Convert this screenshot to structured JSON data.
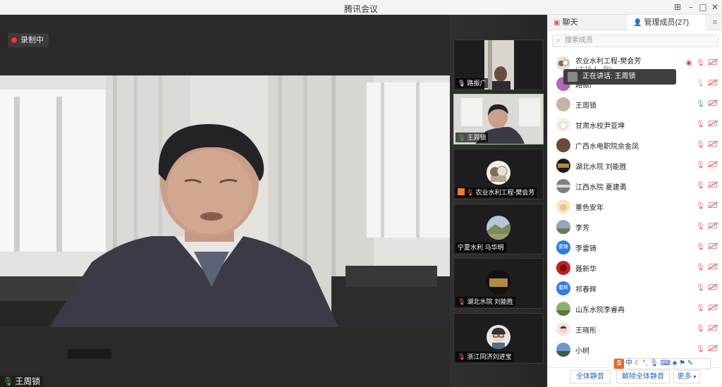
{
  "window": {
    "title": "腾讯会议"
  },
  "stage": {
    "recording_label": "录制中",
    "speaker_name": "王周锁"
  },
  "video_strip": [
    {
      "name": "路振广",
      "mic": "on"
    },
    {
      "name": "王周锁",
      "mic": "speaking"
    },
    {
      "name": "农业水利工程-樊会芳",
      "mic": "muted",
      "host": true
    },
    {
      "name": "宁夏水利 马华明",
      "mic": "none"
    },
    {
      "name": "湖北水院 刘能胜",
      "mic": "muted"
    },
    {
      "name": "浙江同济刘进宝",
      "mic": "muted"
    }
  ],
  "panel": {
    "tab_chat": "聊天",
    "tab_members": "管理成员(27)",
    "search_placeholder": "搜索成员",
    "speaking_tip": "正在讲话: 王周锁",
    "host_sub": "(主持人, 我)",
    "members": [
      {
        "name": "农业水利工程-樊会芳",
        "mic": "off",
        "recording": true
      },
      {
        "name": "路振广",
        "mic": "idle"
      },
      {
        "name": "王周锁",
        "mic": "on"
      },
      {
        "name": "甘肃水校尹亚坤",
        "mic": "off"
      },
      {
        "name": "广西水电职院余金凤",
        "mic": "off"
      },
      {
        "name": "湖北水院 刘能胜",
        "mic": "off"
      },
      {
        "name": "江西水院 夏建勇",
        "mic": "off"
      },
      {
        "name": "董色安年",
        "mic": "off"
      },
      {
        "name": "李芳",
        "mic": "off"
      },
      {
        "name": "李雷铸",
        "mic": "off",
        "avatar_text": "雷铸",
        "avatar_color": "#2f7be5"
      },
      {
        "name": "聂新华",
        "mic": "off"
      },
      {
        "name": "祁春辉",
        "mic": "off",
        "avatar_text": "春辉",
        "avatar_color": "#2f7be5"
      },
      {
        "name": "山东水院李睿冉",
        "mic": "off"
      },
      {
        "name": "王晓彤",
        "mic": "off"
      },
      {
        "name": "小树",
        "mic": "off"
      }
    ],
    "btn_mute_all": "全体静音",
    "btn_unmute_all": "解除全体静音",
    "btn_more": "更多"
  },
  "ime": {
    "logo": "S",
    "mode": "中"
  }
}
